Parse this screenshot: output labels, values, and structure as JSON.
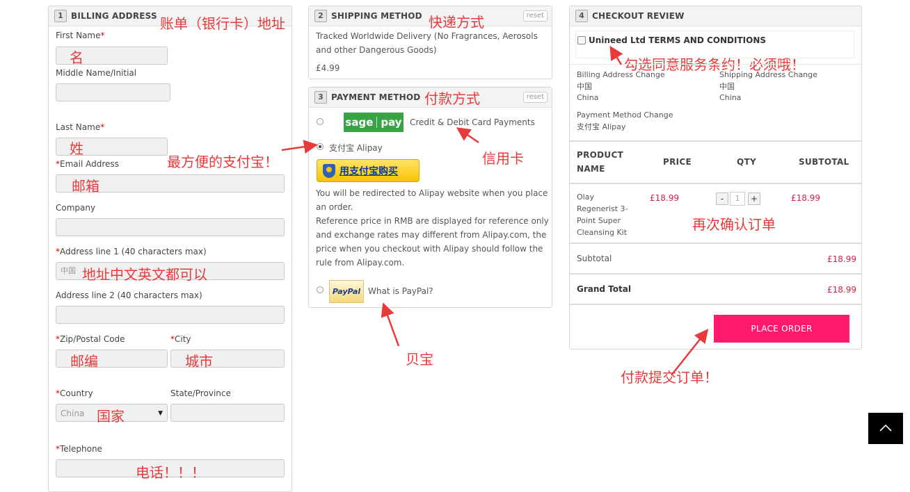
{
  "billing": {
    "step": "1",
    "title": "BILLING ADDRESS",
    "annotation": "账单（银行卡）地址",
    "first_name_label": "First Name",
    "first_name_ann": "名",
    "middle_name_label": "Middle Name/Initial",
    "last_name_label": "Last Name",
    "last_name_ann": "姓",
    "email_label": "Email Address",
    "email_ann": "邮箱",
    "company_label": "Company",
    "address1_label": "Address line 1 (40 characters max)",
    "address1_value": "中国",
    "address1_ann": "地址中文英文都可以",
    "address2_label": "Address line 2 (40 characters max)",
    "zip_label": "Zip/Postal Code",
    "zip_ann": "邮编",
    "city_label": "City",
    "city_ann": "城市",
    "country_label": "Country",
    "country_value": "China",
    "country_ann": "国家",
    "state_label": "State/Province",
    "telephone_label": "Telephone",
    "telephone_ann": "电话！！！",
    "required_mark": "*"
  },
  "shipping": {
    "step": "2",
    "title": "SHIPPING METHOD",
    "annotation": "快递方式",
    "reset_label": "reset",
    "method_text": "Tracked Worldwide Delivery (No Fragrances, Aerosols and other Dangerous Goods)",
    "price": "£4.99"
  },
  "payment": {
    "step": "3",
    "title": "PAYMENT METHOD",
    "annotation": "付款方式",
    "reset_label": "reset",
    "sagepay_logo_left": "sage",
    "sagepay_logo_right": "pay",
    "sagepay_label": "Credit & Debit Card Payments",
    "sagepay_ann": "信用卡",
    "alipay_label": "支付宝 Alipay",
    "alipay_ann": "最方便的支付宝！",
    "alipay_button": "用支付宝购买",
    "alipay_note1": "You will be redirected to Alipay website when you place an order.",
    "alipay_note2": "Reference price in RMB are displayed for reference only and exchange rates may different from Alipay.com, the price when you checkout with Alipay should follow the rule from Alipay.com.",
    "paypal_logo": "PayPal",
    "paypal_label": "What is PayPal?",
    "paypal_ann": "贝宝"
  },
  "review": {
    "step": "4",
    "title": "CHECKOUT REVIEW",
    "terms_label": "Unineed Ltd TERMS AND CONDITIONS",
    "terms_ann": "勾选同意服务条约！必须哦！",
    "billing_change_label": "Billing Address Change",
    "billing_change_cn": "中国",
    "billing_change_en": "China",
    "shipping_change_label": "Shipping Address Change",
    "shipping_change_cn": "中国",
    "shipping_change_en": "China",
    "payment_change_label": "Payment Method Change",
    "payment_change_value": "支付宝 Alipay",
    "col_product": "PRODUCT NAME",
    "col_price": "PRICE",
    "col_qty": "QTY",
    "col_subtotal": "SUBTOTAL",
    "item_name": "Olay Regenerist 3-Point Super Cleansing Kit",
    "item_price": "£18.99",
    "item_qty": "1",
    "qty_minus": "-",
    "qty_plus": "+",
    "item_subtotal": "£18.99",
    "confirm_ann": "再次确认订单",
    "subtotal_label": "Subtotal",
    "subtotal_value": "£18.99",
    "grand_total_label": "Grand Total",
    "grand_total_value": "£18.99",
    "place_order": "PLACE ORDER",
    "place_order_ann": "付款提交订单！"
  },
  "colors": {
    "place_order_bg": "#ff1a6c",
    "annotation": "#e83a3a",
    "price": "#d6204a",
    "sagepay_green": "#3aa346"
  },
  "icons": {
    "back_to_top": "chevron-up-icon"
  }
}
